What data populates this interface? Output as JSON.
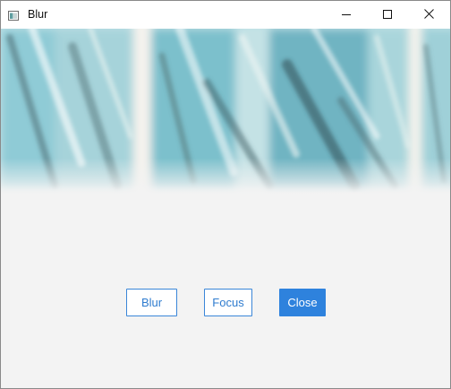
{
  "window": {
    "title": "Blur",
    "icon": "app-window-icon"
  },
  "controls": {
    "minimize_icon": "minimize-icon",
    "maximize_icon": "maximize-icon",
    "close_icon": "close-icon"
  },
  "image": {
    "description_icon": "blurred-image",
    "tint": "#7fc4d0"
  },
  "buttons": {
    "blur_label": "Blur",
    "focus_label": "Focus",
    "close_label": "Close"
  },
  "colors": {
    "accent": "#2e82dd",
    "window_bg": "#f3f3f3"
  }
}
